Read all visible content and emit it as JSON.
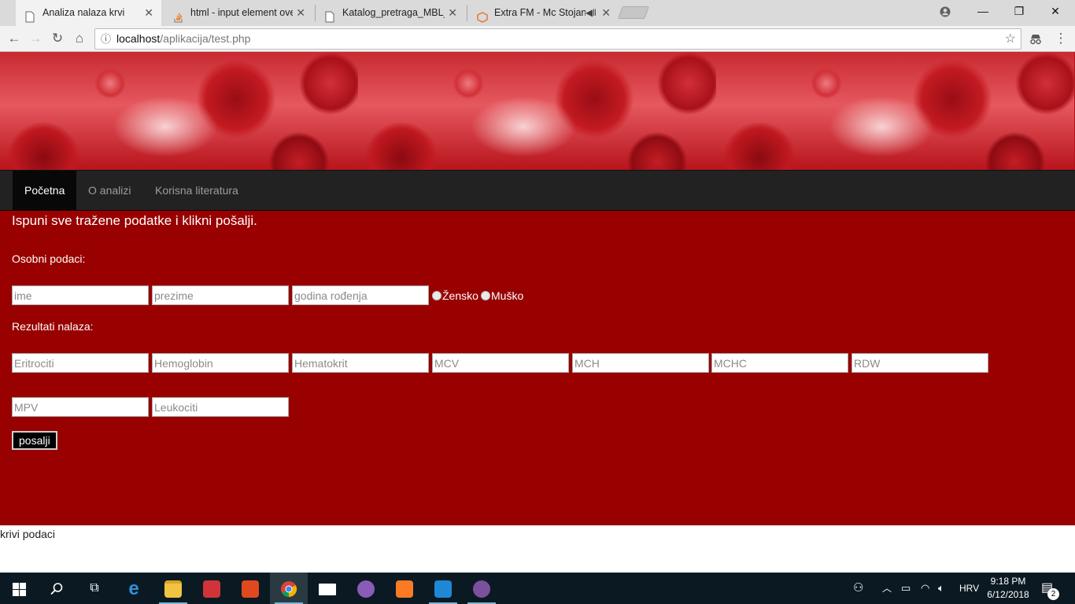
{
  "browser": {
    "tabs": [
      {
        "title": "Analiza nalaza krvi",
        "active": true,
        "icon": "page-icon"
      },
      {
        "title": "html - input element ove",
        "active": false,
        "icon": "stackoverflow-icon"
      },
      {
        "title": "Katalog_pretraga_MBL_Sa",
        "active": false,
        "icon": "page-icon"
      },
      {
        "title": "Extra FM - Mc Stojan",
        "active": false,
        "icon": "extrafm-icon"
      }
    ],
    "address": {
      "host": "localhost",
      "path": "/aplikacija/test.php"
    }
  },
  "nav": {
    "items": [
      "Početna",
      "O analizi",
      "Korisna literatura"
    ]
  },
  "form": {
    "instruction": "Ispuni sve tražene podatke i klikni pošalji.",
    "personal_label": "Osobni podaci:",
    "results_label": "Rezultati nalaza:",
    "personal_fields": [
      "ime",
      "prezime",
      "godina rođenja"
    ],
    "gender": {
      "female": "Žensko",
      "male": "Muško"
    },
    "result_fields": [
      "Eritrociti",
      "Hemoglobin",
      "Hematokrit",
      "MCV",
      "MCH",
      "MCHC",
      "RDW",
      "MPV",
      "Leukociti"
    ],
    "submit_label": "posalji"
  },
  "footer_text": "krivi podaci",
  "taskbar": {
    "language": "HRV",
    "time": "9:18 PM",
    "date": "6/12/2018",
    "notification_count": "2"
  },
  "colors": {
    "content_background": "#990000",
    "navbar": "#222222",
    "taskbar": "#0b1a22"
  }
}
